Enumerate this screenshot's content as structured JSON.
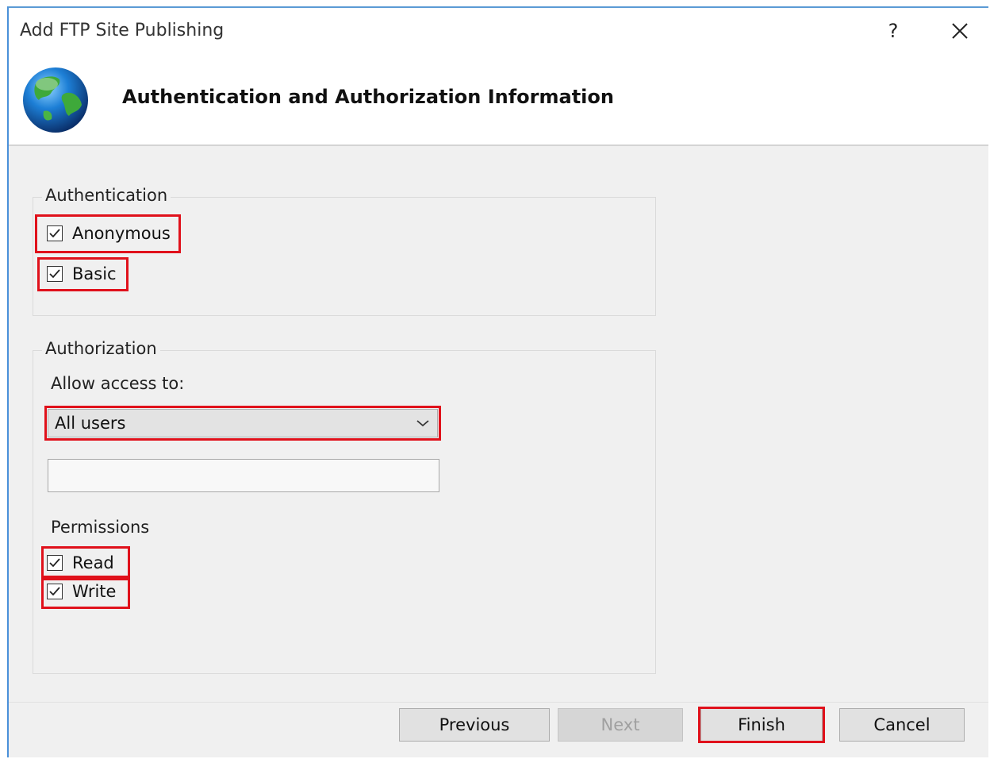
{
  "window": {
    "title": "Add FTP Site Publishing",
    "help_label": "?"
  },
  "header": {
    "title": "Authentication and Authorization Information",
    "icon": "globe-icon"
  },
  "authentication": {
    "legend": "Authentication",
    "options": [
      {
        "label": "Anonymous",
        "checked": true
      },
      {
        "label": "Basic",
        "checked": true
      }
    ]
  },
  "authorization": {
    "legend": "Authorization",
    "allow_access_label": "Allow access to:",
    "allow_access_value": "All users",
    "user_field_value": "",
    "permissions_label": "Permissions",
    "permissions": [
      {
        "label": "Read",
        "checked": true
      },
      {
        "label": "Write",
        "checked": true
      }
    ]
  },
  "buttons": {
    "previous": "Previous",
    "next": "Next",
    "finish": "Finish",
    "cancel": "Cancel"
  },
  "colors": {
    "highlight": "#e0111b",
    "accent": "#4a90d9"
  }
}
